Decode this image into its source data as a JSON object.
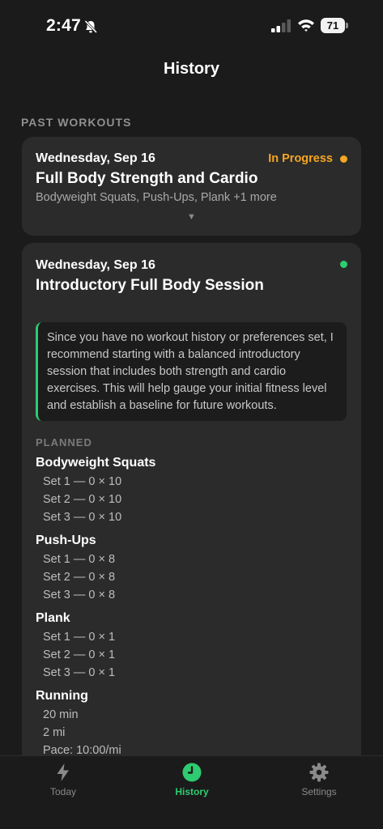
{
  "status_bar": {
    "time": "2:47",
    "battery": "71"
  },
  "header": {
    "title": "History"
  },
  "section_label": "PAST WORKOUTS",
  "workouts": [
    {
      "date": "Wednesday, Sep 16",
      "title": "Full Body Strength and Cardio",
      "status": "In Progress",
      "status_color": "#f5a623",
      "summary": "Bodyweight Squats, Push-Ups, Plank +1 more",
      "expand_icon": "chevron-down-icon"
    },
    {
      "date": "Wednesday, Sep 16",
      "title": "Introductory Full Body Session",
      "status_color": "#2ecc71",
      "recommendation": "Since you have no workout history or preferences set, I recommend starting with a balanced introductory session that includes both strength and cardio exercises. This will help gauge your initial fitness level and establish a baseline for future workouts.",
      "planned_label": "PLANNED",
      "exercises": [
        {
          "name": "Bodyweight Squats",
          "sets": [
            "Set 1 — 0 × 10",
            "Set 2 — 0 × 10",
            "Set 3 — 0 × 10"
          ]
        },
        {
          "name": "Push-Ups",
          "sets": [
            "Set 1 — 0 × 8",
            "Set 2 — 0 × 8",
            "Set 3 — 0 × 8"
          ]
        },
        {
          "name": "Plank",
          "sets": [
            "Set 1 — 0 × 1",
            "Set 2 — 0 × 1",
            "Set 3 — 0 × 1"
          ]
        },
        {
          "name": "Running",
          "sets": [
            "20 min",
            "2 mi",
            "Pace: 10:00/mi"
          ]
        }
      ]
    }
  ],
  "tab_bar": {
    "tabs": [
      {
        "label": "Today",
        "icon": "bolt-icon"
      },
      {
        "label": "History",
        "icon": "clock-icon",
        "active": true
      },
      {
        "label": "Settings",
        "icon": "gear-icon"
      }
    ],
    "active_color": "#2ecc71"
  }
}
